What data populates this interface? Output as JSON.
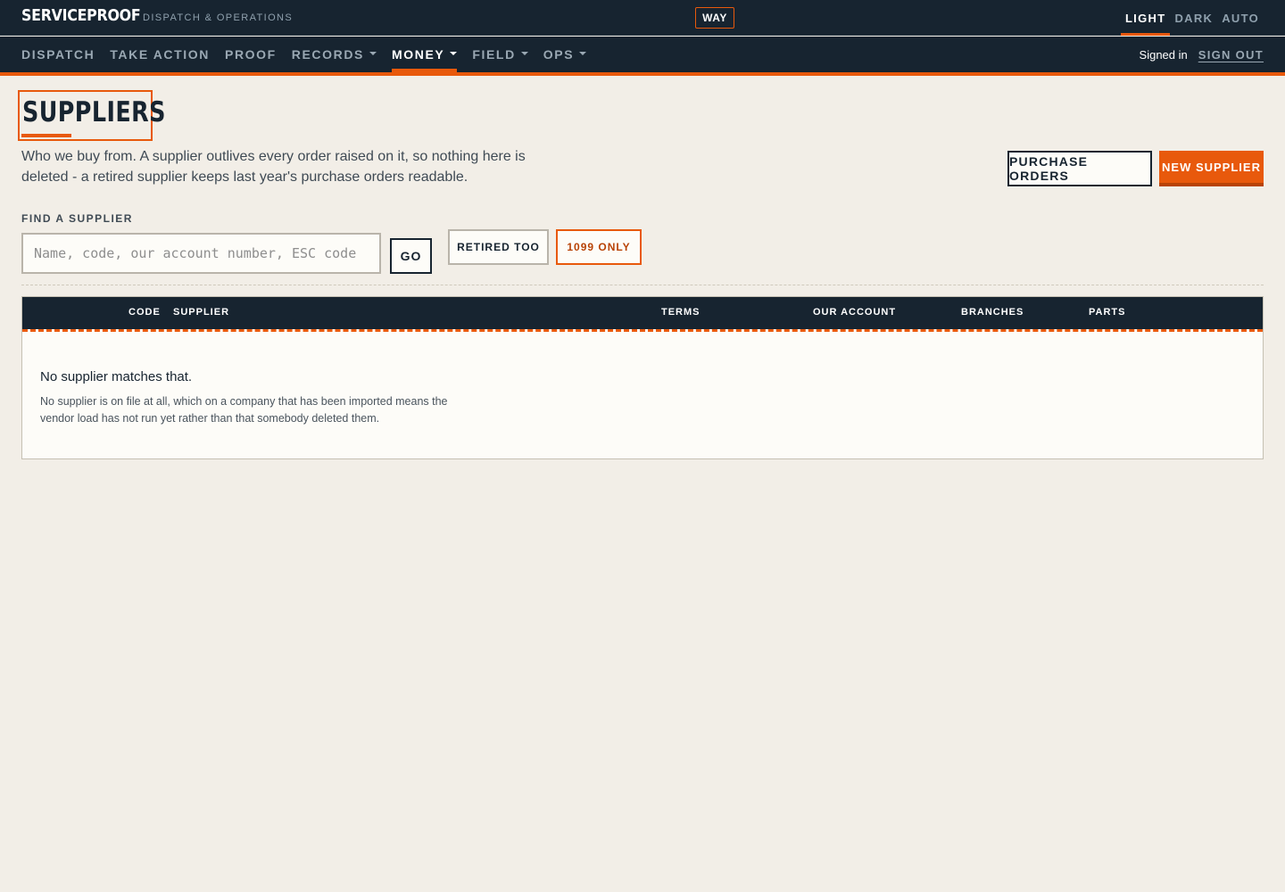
{
  "app": {
    "brand": "SERVICEPROOF",
    "tagline": "DISPATCH & OPERATIONS",
    "badge": "WAY"
  },
  "theme": {
    "options": [
      "LIGHT",
      "DARK",
      "AUTO"
    ],
    "selected": "LIGHT"
  },
  "nav": {
    "items": [
      {
        "label": "DISPATCH",
        "dropdown": false
      },
      {
        "label": "TAKE ACTION",
        "dropdown": false
      },
      {
        "label": "PROOF",
        "dropdown": false
      },
      {
        "label": "RECORDS",
        "dropdown": true
      },
      {
        "label": "MONEY",
        "dropdown": true,
        "active": true
      },
      {
        "label": "FIELD",
        "dropdown": true
      },
      {
        "label": "OPS",
        "dropdown": true
      }
    ],
    "signed_in": "Signed in",
    "sign_out": "SIGN OUT"
  },
  "page": {
    "title": "SUPPLIERS",
    "intro": "Who we buy from. A supplier outlives every order raised on it, so nothing here is deleted - a retired supplier keeps last year's purchase orders readable."
  },
  "actions": {
    "purchase_orders": "PURCHASE ORDERS",
    "new_supplier": "NEW SUPPLIER"
  },
  "search": {
    "label": "FIND A SUPPLIER",
    "placeholder": "Name, code, our account number, ESC code",
    "value": "",
    "go": "GO"
  },
  "filters": {
    "retired_too": "RETIRED TOO",
    "only_1099": "1099 ONLY",
    "only_1099_active": true
  },
  "table": {
    "columns": {
      "code": "CODE",
      "supplier": "SUPPLIER",
      "terms": "TERMS",
      "our_account": "OUR ACCOUNT",
      "branches": "BRANCHES",
      "parts": "PARTS"
    },
    "rows": [],
    "empty_title": "No supplier matches that.",
    "empty_body": "No supplier is on file at all, which on a company that has been imported means the vendor load has not run yet rather than that somebody deleted them."
  },
  "colors": {
    "navy": "#172430",
    "accent": "#e8590c",
    "page_bg": "#f2eee7",
    "panel_bg": "#fdfcf8"
  }
}
